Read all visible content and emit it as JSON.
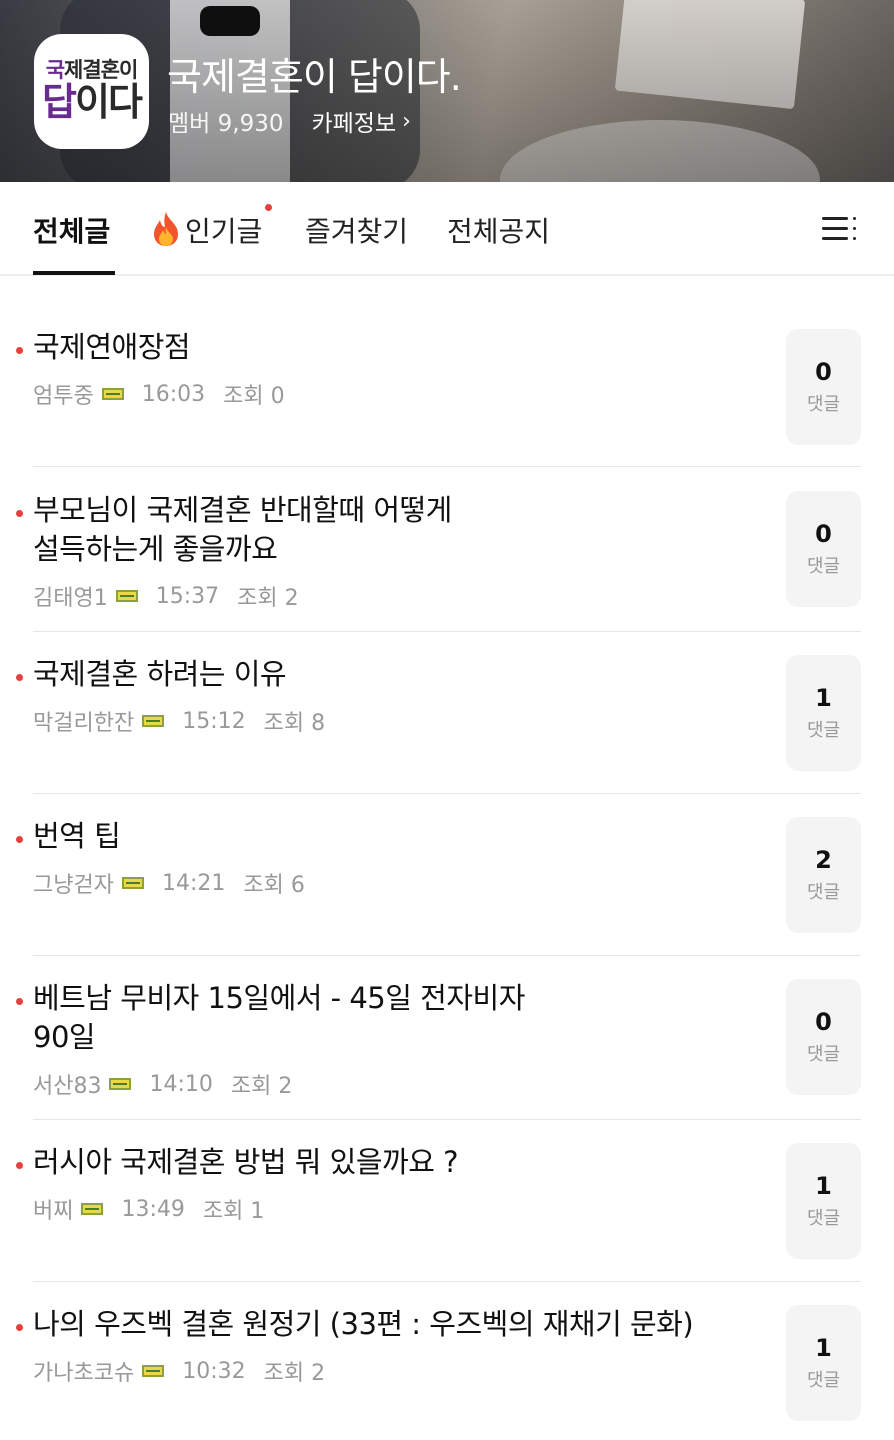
{
  "cafe": {
    "logo_line1_a": "국",
    "logo_line1_b": "제결혼이",
    "logo_line2_a": "답",
    "logo_line2_b": "이다",
    "title": "국제결혼이 답이다.",
    "members": "멤버 9,930",
    "info_label": "카페정보",
    "info_chevron": "›"
  },
  "tabs": {
    "all": "전체글",
    "popular": "인기글",
    "favorites": "즐겨찾기",
    "notices": "전체공지"
  },
  "comment_label": "댓글",
  "posts": [
    {
      "title_line1": "국제연애장점",
      "title_line2": "",
      "author": "엄투중",
      "time": "16:03",
      "views": "조회 0",
      "comments": "0"
    },
    {
      "title_line1": "부모님이 국제결혼 반대할때 어떻게",
      "title_line2": "설득하는게 좋을까요",
      "author": "김태영1",
      "time": "15:37",
      "views": "조회 2",
      "comments": "0"
    },
    {
      "title_line1": "국제결혼 하려는 이유",
      "title_line2": "",
      "author": "막걸리한잔",
      "time": "15:12",
      "views": "조회 8",
      "comments": "1"
    },
    {
      "title_line1": "번역 팁",
      "title_line2": "",
      "author": "그냥걷자",
      "time": "14:21",
      "views": "조회 6",
      "comments": "2"
    },
    {
      "title_line1": "베트남 무비자  15일에서 - 45일 전자비자",
      "title_line2": "90일",
      "author": "서산83",
      "time": "14:10",
      "views": "조회 2",
      "comments": "0"
    },
    {
      "title_line1": "러시아 국제결혼 방법 뭐 있을까요 ?",
      "title_line2": "",
      "author": "버찌",
      "time": "13:49",
      "views": "조회 1",
      "comments": "1"
    },
    {
      "title_line1": "나의 우즈벡 결혼 원정기 (33편 : 우즈벡의 재채기 문화)",
      "title_line2": "",
      "author": "가나초코슈",
      "time": "10:32",
      "views": "조회 2",
      "comments": "1"
    }
  ],
  "colors": {
    "accent_red": "#e5413c",
    "logo_purple": "#6a2b8e",
    "comment_box_bg": "#f4f4f5"
  },
  "icons": [
    "fire-icon",
    "menu-icon",
    "chevron-right-icon",
    "member-level-badge-icon"
  ]
}
